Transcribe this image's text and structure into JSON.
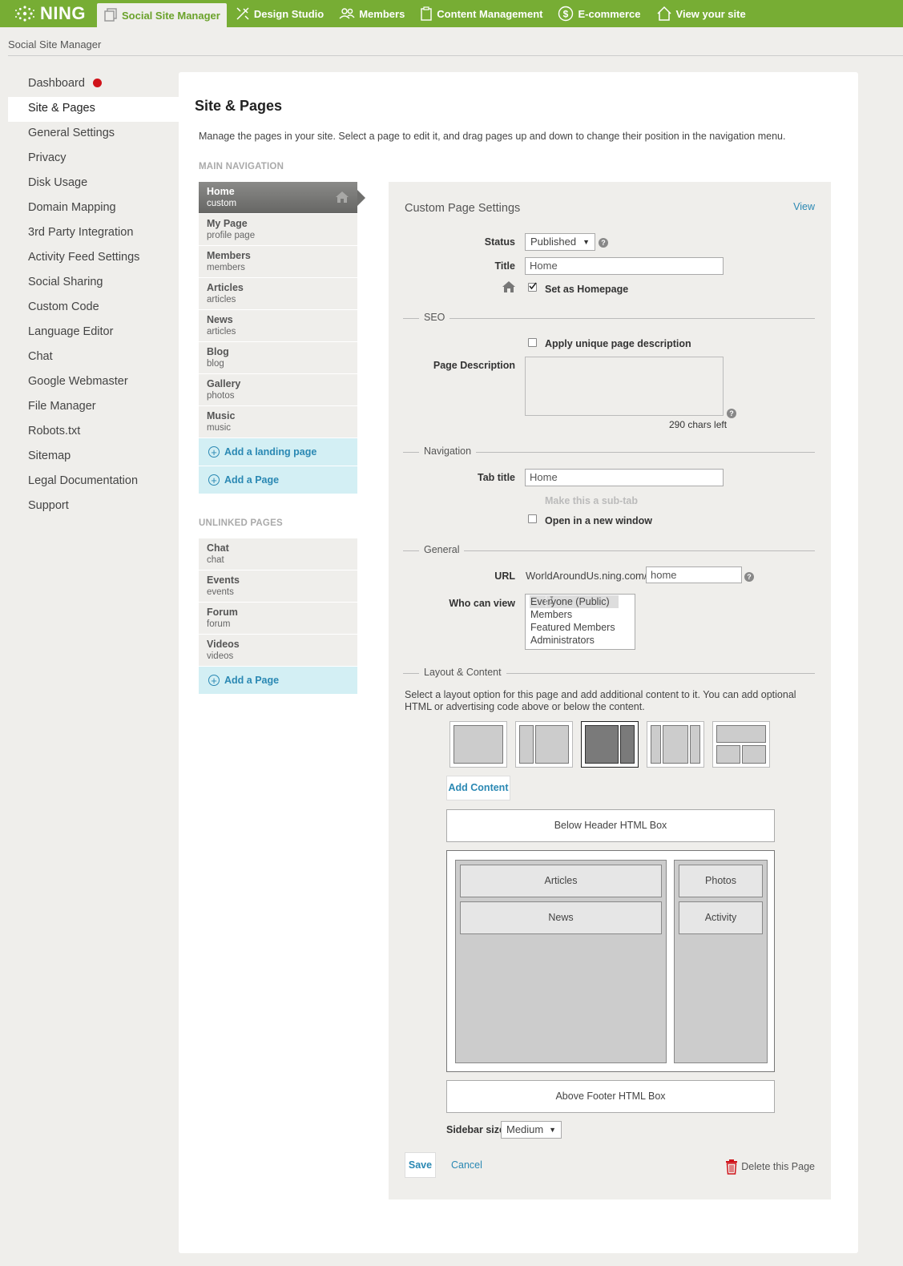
{
  "topbar": {
    "logo": "NING",
    "tabs": [
      {
        "label": "Social Site Manager",
        "icon": "pages-icon",
        "active": true
      },
      {
        "label": "Design Studio",
        "icon": "design-tools-icon"
      },
      {
        "label": "Members",
        "icon": "members-icon"
      },
      {
        "label": "Content Management",
        "icon": "clipboard-icon"
      },
      {
        "label": "E-commerce",
        "icon": "dollar-icon"
      },
      {
        "label": "View your site",
        "icon": "house-icon"
      }
    ]
  },
  "breadcrumb": "Social Site Manager",
  "sidebar": {
    "items": [
      {
        "label": "Dashboard",
        "notification": true
      },
      {
        "label": "Site & Pages",
        "active": true
      },
      {
        "label": "General Settings"
      },
      {
        "label": "Privacy"
      },
      {
        "label": "Disk Usage"
      },
      {
        "label": "Domain Mapping"
      },
      {
        "label": "3rd Party Integration"
      },
      {
        "label": "Activity Feed Settings"
      },
      {
        "label": "Social Sharing"
      },
      {
        "label": "Custom Code"
      },
      {
        "label": "Language Editor"
      },
      {
        "label": "Chat"
      },
      {
        "label": "Google Webmaster"
      },
      {
        "label": "File Manager"
      },
      {
        "label": "Robots.txt"
      },
      {
        "label": "Sitemap"
      },
      {
        "label": "Legal Documentation"
      },
      {
        "label": "Support"
      }
    ]
  },
  "main": {
    "title": "Site & Pages",
    "intro": "Manage the pages in your site. Select a page to edit it, and drag pages up and down to change their position in the navigation menu.",
    "main_nav_heading": "MAIN NAVIGATION",
    "main_nav": [
      {
        "name": "Home",
        "type": "custom",
        "active": true
      },
      {
        "name": "My Page",
        "type": "profile page"
      },
      {
        "name": "Members",
        "type": "members"
      },
      {
        "name": "Articles",
        "type": "articles"
      },
      {
        "name": "News",
        "type": "articles"
      },
      {
        "name": "Blog",
        "type": "blog"
      },
      {
        "name": "Gallery",
        "type": "photos"
      },
      {
        "name": "Music",
        "type": "music"
      }
    ],
    "add_landing_page": "Add a landing page",
    "add_page": "Add a Page",
    "unlinked_heading": "UNLINKED PAGES",
    "unlinked": [
      {
        "name": "Chat",
        "type": "chat"
      },
      {
        "name": "Events",
        "type": "events"
      },
      {
        "name": "Forum",
        "type": "forum"
      },
      {
        "name": "Videos",
        "type": "videos"
      }
    ],
    "add_page_2": "Add a Page"
  },
  "settings": {
    "title": "Custom Page Settings",
    "view_link": "View",
    "status_label": "Status",
    "status_value": "Published",
    "title_label": "Title",
    "title_value": "Home",
    "homepage_label": "Set as Homepage",
    "homepage_checked": true,
    "seo_heading": "SEO",
    "unique_desc_label": "Apply unique page description",
    "page_desc_label": "Page Description",
    "chars_left": "290 chars left",
    "navigation_heading": "Navigation",
    "tab_title_label": "Tab title",
    "tab_title_value": "Home",
    "subtab_label": "Make this a sub-tab",
    "new_window_label": "Open in a new window",
    "general_heading": "General",
    "url_label": "URL",
    "url_prefix": "WorldAroundUs.ning.com/",
    "url_value": "home",
    "who_can_view_label": "Who can view",
    "who_can_view_options": [
      "Everyone (Public)",
      "Members",
      "Featured Members",
      "Administrators"
    ],
    "who_can_view_selected": "Everyone (Public)",
    "layout_heading": "Layout & Content",
    "layout_desc": "Select a layout option for this page and add additional content to it. You can add optional HTML or advertising code above or below the content.",
    "add_content": "Add Content",
    "below_header": "Below Header HTML Box",
    "main_modules": [
      "Articles",
      "News"
    ],
    "side_modules": [
      "Photos",
      "Activity"
    ],
    "above_footer": "Above Footer HTML Box",
    "sidebar_size_label": "Sidebar size:",
    "sidebar_size_value": "Medium",
    "save": "Save",
    "cancel": "Cancel",
    "delete": "Delete this Page"
  },
  "colors": {
    "brand_green": "#77ad34",
    "link_blue": "#2a88b3",
    "notification_red": "#d0131a",
    "add_row_bg": "#d3eff4"
  }
}
